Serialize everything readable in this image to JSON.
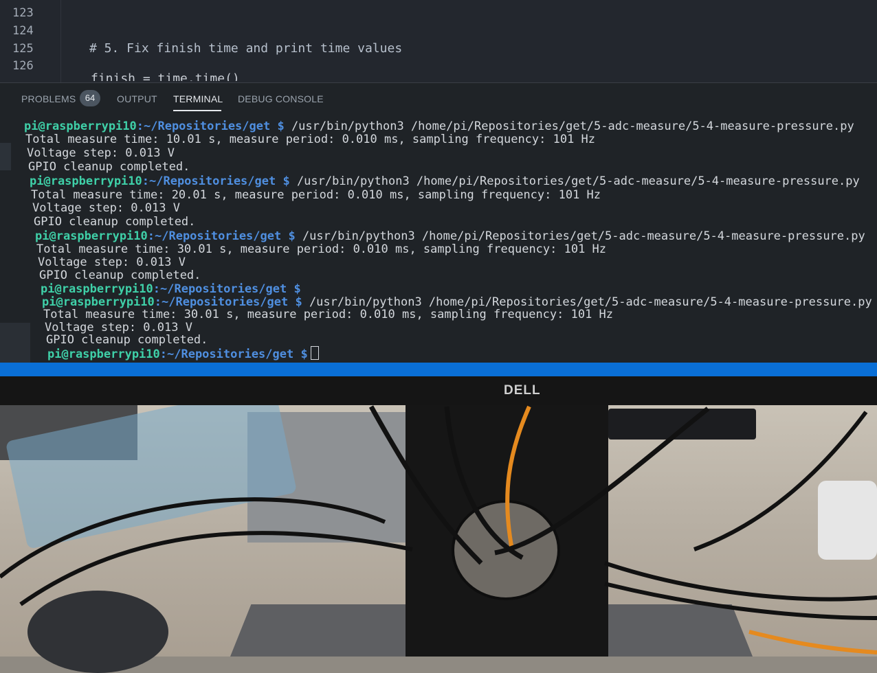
{
  "editor": {
    "lines": [
      {
        "no": "123",
        "code": ""
      },
      {
        "no": "124",
        "code": ""
      },
      {
        "no": "125",
        "code": "# 5. Fix finish time and print time values"
      },
      {
        "no": "126",
        "code": ""
      }
    ],
    "partial_line": "finish = time.time()"
  },
  "panel": {
    "tabs": [
      {
        "label": "PROBLEMS",
        "active": false
      },
      {
        "label": "OUTPUT",
        "active": false
      },
      {
        "label": "TERMINAL",
        "active": true
      },
      {
        "label": "DEBUG CONSOLE",
        "active": false
      }
    ],
    "problems_count": "64"
  },
  "terminal": {
    "user": "pi@raspberrypi10",
    "path": ":~/Repositories/get $",
    "command": " /usr/bin/python3 /home/pi/Repositories/get/5-adc-measure/5-4-measure-pressure.py",
    "runs": [
      {
        "total": "Total measure time: 10.01 s, measure period: 0.010 ms, sampling frequency: 101 Hz",
        "step": "Voltage step: 0.013 V",
        "cleanup": "GPIO cleanup completed."
      },
      {
        "total": "Total measure time: 20.01 s, measure period: 0.010 ms, sampling frequency: 101 Hz",
        "step": "Voltage step: 0.013 V",
        "cleanup": "GPIO cleanup completed."
      },
      {
        "total": "Total measure time: 30.01 s, measure period: 0.010 ms, sampling frequency: 101 Hz",
        "step": "Voltage step: 0.013 V",
        "cleanup": "GPIO cleanup completed."
      },
      {
        "total": "Total measure time: 30.01 s, measure period: 0.010 ms, sampling frequency: 101 Hz",
        "step": "Voltage step: 0.013 V",
        "cleanup": "GPIO cleanup completed."
      }
    ]
  },
  "monitor": {
    "brand": "DELL"
  },
  "colors": {
    "prompt_user": "#3fd0a8",
    "prompt_path": "#4f8fe0",
    "status_bar": "#0a6fd6"
  }
}
